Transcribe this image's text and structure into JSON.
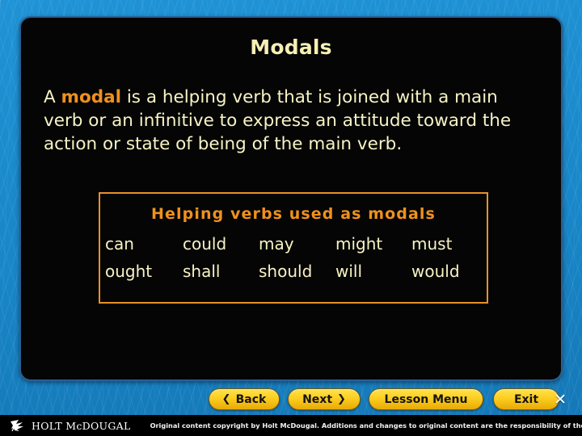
{
  "slide": {
    "title": "Modals",
    "body": {
      "before": "A ",
      "keyword": "modal",
      "after": " is a helping verb that is joined with a main verb or an infinitive to express an attitude toward the action or state of being of the main verb."
    },
    "modal_box": {
      "heading": "Helping verbs used as modals",
      "rows": [
        [
          "can",
          "could",
          "may",
          "might",
          "must"
        ],
        [
          "ought",
          "shall",
          "should",
          "will",
          "would"
        ]
      ]
    }
  },
  "nav": {
    "back_label": "Back",
    "back_chevron": "❮",
    "next_label": "Next",
    "next_chevron": "❯",
    "menu_label": "Lesson Menu",
    "exit_label": "Exit",
    "exit_glyph": "✕"
  },
  "footer": {
    "brand": "HOLT McDOUGAL",
    "copyright": "Original content copyright by Holt McDougal.  Additions and changes to original content are the responsibility of the instructor."
  },
  "colors": {
    "background_blue": "#1b8ed0",
    "panel_black": "#050505",
    "title_cream": "#f7efb4",
    "body_cream": "#f7f3c4",
    "keyword_orange": "#f0911c",
    "box_border_orange": "#e8912a",
    "button_gold": "#fdd022"
  }
}
